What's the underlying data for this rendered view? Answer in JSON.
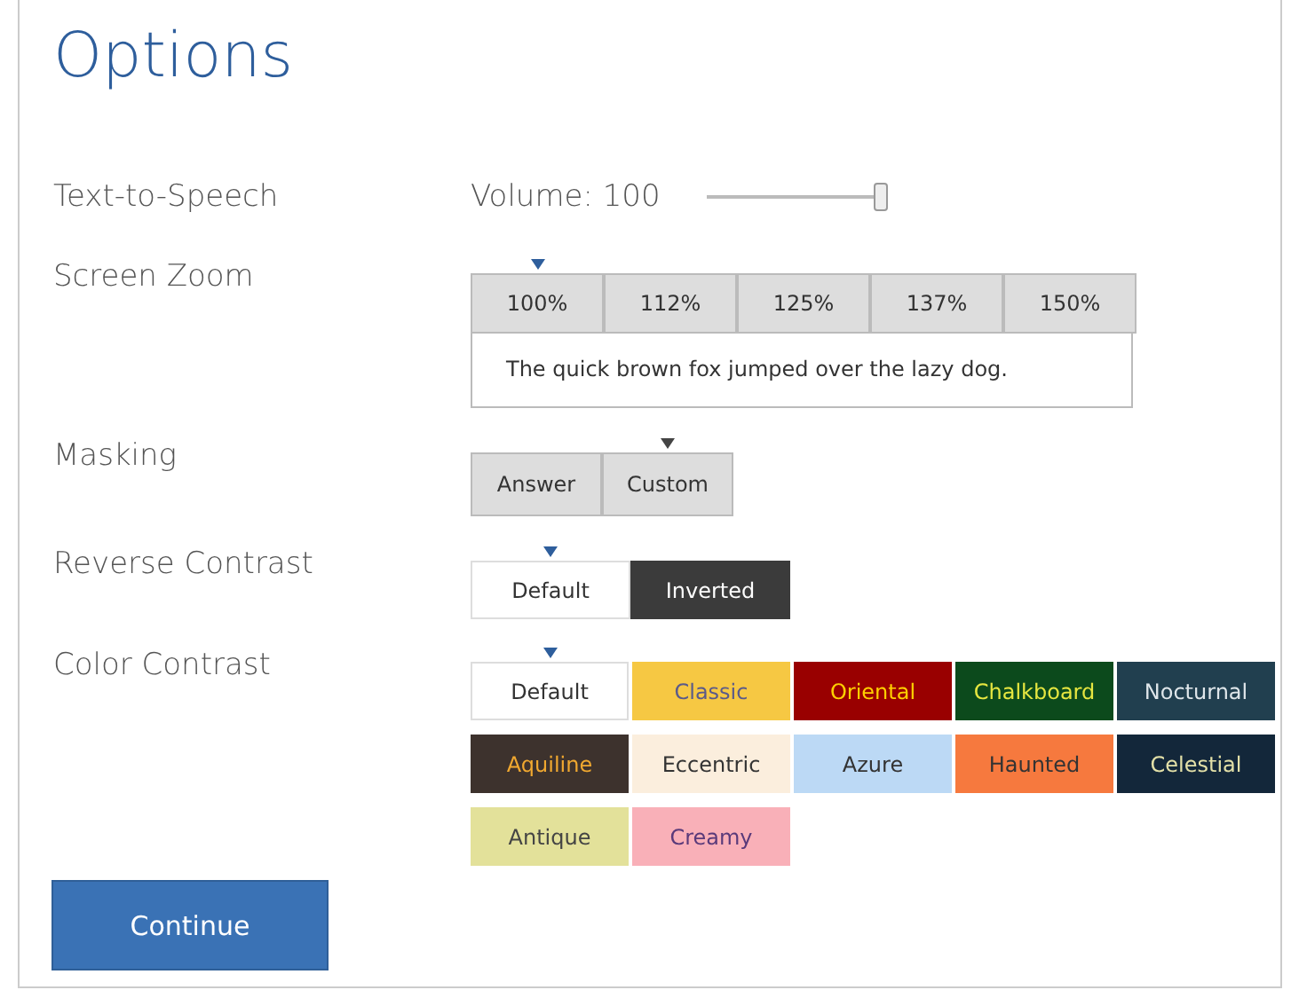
{
  "title": "Options",
  "text_to_speech": {
    "label": "Text-to-Speech",
    "reading": "Volume: 100",
    "level": 1.0
  },
  "screen_zoom": {
    "label": "Screen Zoom",
    "options": [
      {
        "label": "100%",
        "selected": true
      },
      {
        "label": "112%",
        "selected": false
      },
      {
        "label": "125%",
        "selected": false
      },
      {
        "label": "137%",
        "selected": false
      },
      {
        "label": "150%",
        "selected": false
      }
    ],
    "sample": "The quick brown fox jumped over the lazy dog."
  },
  "masking": {
    "label": "Masking",
    "options": [
      {
        "label": "Answer",
        "selected": false
      },
      {
        "label": "Custom",
        "selected": true
      }
    ]
  },
  "reverse_contrast": {
    "label": "Reverse Contrast",
    "options": [
      {
        "label": "Default",
        "selected": true,
        "color": "#ffffff",
        "text": {
          "color": "#333333"
        }
      },
      {
        "label": "Inverted",
        "selected": false,
        "color": "#3b3b3b",
        "text": {
          "color": "#ffffff"
        }
      }
    ]
  },
  "color_contrast": {
    "label": "Color Contrast",
    "options": [
      {
        "label": "Default",
        "selected": true,
        "color": "#ffffff",
        "text": {
          "color": "#333333"
        }
      },
      {
        "label": "Classic",
        "selected": false,
        "color": "#f6c843",
        "text": {
          "color": "#5a5a8a"
        }
      },
      {
        "label": "Oriental",
        "selected": false,
        "color": "#990000",
        "text": {
          "color": "#ffd000"
        }
      },
      {
        "label": "Chalkboard",
        "selected": false,
        "color": "#0c4a1c",
        "text": {
          "color": "#e6e640"
        }
      },
      {
        "label": "Nocturnal",
        "selected": false,
        "color": "#213f4f",
        "text": {
          "color": "#dfe6ea"
        }
      },
      {
        "label": "Aquiline",
        "selected": false,
        "color": "#3d322d",
        "text": {
          "color": "#f0a830"
        }
      },
      {
        "label": "Eccentric",
        "selected": false,
        "color": "#fbeedd",
        "text": {
          "color": "#333333"
        }
      },
      {
        "label": "Azure",
        "selected": false,
        "color": "#bcd9f5",
        "text": {
          "color": "#333333"
        }
      },
      {
        "label": "Haunted",
        "selected": false,
        "color": "#f6793e",
        "text": {
          "color": "#333333"
        }
      },
      {
        "label": "Celestial",
        "selected": false,
        "color": "#13273a",
        "text": {
          "color": "#e3e0a8"
        }
      },
      {
        "label": "Antique",
        "selected": false,
        "color": "#e3e19a",
        "text": {
          "color": "#444444"
        }
      },
      {
        "label": "Creamy",
        "selected": false,
        "color": "#f9b0b8",
        "text": {
          "color": "#5a3a7a"
        }
      }
    ]
  },
  "continue_button": "Continue"
}
